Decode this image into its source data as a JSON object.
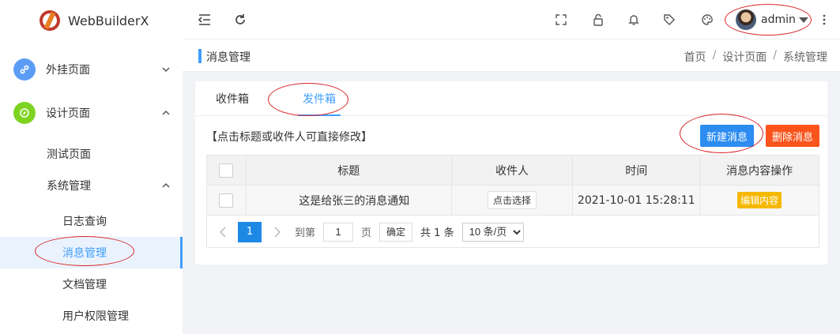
{
  "app": {
    "name": "WebBuilderX"
  },
  "sidebar": {
    "groups": [
      {
        "label": "外挂页面",
        "icon": "link-icon",
        "color": "#5b9df5",
        "expanded": false
      },
      {
        "label": "设计页面",
        "icon": "compass-icon",
        "color": "#7ed321",
        "expanded": true
      }
    ],
    "items": [
      {
        "label": "测试页面"
      },
      {
        "label": "系统管理"
      },
      {
        "label": "日志查询"
      },
      {
        "label": "消息管理",
        "active": true
      },
      {
        "label": "文档管理"
      },
      {
        "label": "用户权限管理"
      }
    ]
  },
  "topbar": {
    "icons": [
      "menu-fold-icon",
      "refresh-icon",
      "fullscreen-icon",
      "lock-icon",
      "bell-icon",
      "tag-icon",
      "palette-icon",
      "more-icon"
    ],
    "user": "admin"
  },
  "titlebar": {
    "title": "消息管理",
    "breadcrumb": [
      "首页",
      "设计页面",
      "系统管理"
    ],
    "sep": "/"
  },
  "tabs": [
    {
      "label": "收件箱"
    },
    {
      "label": "发件箱",
      "active": true
    }
  ],
  "hint": "【点击标题或收件人可直接修改】",
  "buttons": {
    "new": "新建消息",
    "delete": "删除消息"
  },
  "table": {
    "columns": [
      "标题",
      "收件人",
      "时间",
      "消息内容操作"
    ],
    "rows": [
      {
        "title": "这是给张三的消息通知",
        "recipient": "点击选择",
        "time": "2021-10-01 15:28:11",
        "action": "编辑内容"
      }
    ]
  },
  "pager": {
    "current": "1",
    "goto_label": "到第",
    "page_value": "1",
    "page_unit": "页",
    "ok": "确定",
    "total": "共 1 条",
    "page_size": "10 条/页"
  },
  "colors": {
    "accent": "#409eff",
    "danger": "#fa541c",
    "primary": "#2d8cf0",
    "warning": "#f5b800",
    "annotation": "#d9242b"
  }
}
